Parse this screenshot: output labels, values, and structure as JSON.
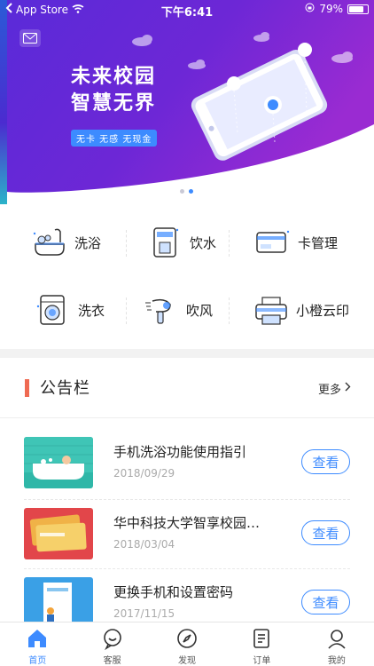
{
  "status_bar": {
    "carrier": "App Store",
    "time": "下午6:41",
    "battery": "79%",
    "battery_level": 0.79
  },
  "banner": {
    "title_line1": "未来校园",
    "title_line2": "智慧无界",
    "tags": "无卡 无感 无现金",
    "colors": {
      "primary": "#4b2bd0",
      "secondary": "#9b2bd0",
      "accent": "#3d8bff"
    }
  },
  "services": [
    {
      "label": "洗浴",
      "icon": "shower-bath-icon"
    },
    {
      "label": "饮水",
      "icon": "water-dispenser-icon"
    },
    {
      "label": "卡管理",
      "icon": "card-icon"
    },
    {
      "label": "洗衣",
      "icon": "washing-machine-icon"
    },
    {
      "label": "吹风",
      "icon": "hair-dryer-icon"
    },
    {
      "label": "小橙云印",
      "icon": "printer-icon"
    }
  ],
  "notice": {
    "title": "公告栏",
    "more": "更多"
  },
  "notices": [
    {
      "title": "手机洗浴功能使用指引",
      "date": "2018/09/29",
      "button": "查看"
    },
    {
      "title": "华中科技大学智享校园…",
      "date": "2018/03/04",
      "button": "查看"
    },
    {
      "title": "更换手机和设置密码",
      "date": "2017/11/15",
      "button": "查看"
    }
  ],
  "tabs": [
    {
      "label": "首页",
      "icon": "home-icon"
    },
    {
      "label": "客服",
      "icon": "customer-service-icon"
    },
    {
      "label": "发现",
      "icon": "discover-icon"
    },
    {
      "label": "订单",
      "icon": "order-icon"
    },
    {
      "label": "我的",
      "icon": "profile-icon"
    }
  ]
}
